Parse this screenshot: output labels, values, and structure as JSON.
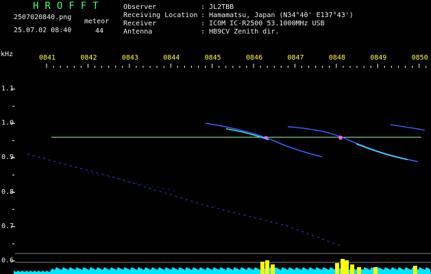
{
  "header": {
    "title": "HROFFT",
    "filename": "2507020840.png",
    "datetime": "25.07.02 08:40",
    "meteor_label": "meteor",
    "meteor_count": "44",
    "info_rows": [
      {
        "label": "Observer",
        "value": ": JL2TBB"
      },
      {
        "label": "Receiving Location",
        "value": ": Hamamatsu, Japan (N34°40' E137°43')"
      },
      {
        "label": "Receiver",
        "value": ": ICOM IC-R2500 53.1000MHz USB"
      },
      {
        "label": "Antenna",
        "value": ": HB9CV Zenith dir."
      }
    ]
  },
  "colors": {
    "background": "#000000",
    "label_green": "#3cff7a",
    "tick_yellow": "#ffff40",
    "carrier_line": "#a0ffa0",
    "noise_floor": "#00e5ff",
    "peaks": "#ffff00"
  },
  "chart_data": {
    "type": "line",
    "title": "",
    "x_tick_labels": [
      "0841",
      "0842",
      "0843",
      "0844",
      "0845",
      "0846",
      "0847",
      "0848",
      "0849",
      "0850"
    ],
    "y_unit_label": "kHz",
    "y_tick_labels": [
      "1.1",
      "1.0",
      "0.9",
      "0.8",
      "0.7",
      "0.6"
    ],
    "y_range": [
      0.58,
      1.17
    ],
    "carrier_frequency_khz": 0.96,
    "grid": false
  }
}
